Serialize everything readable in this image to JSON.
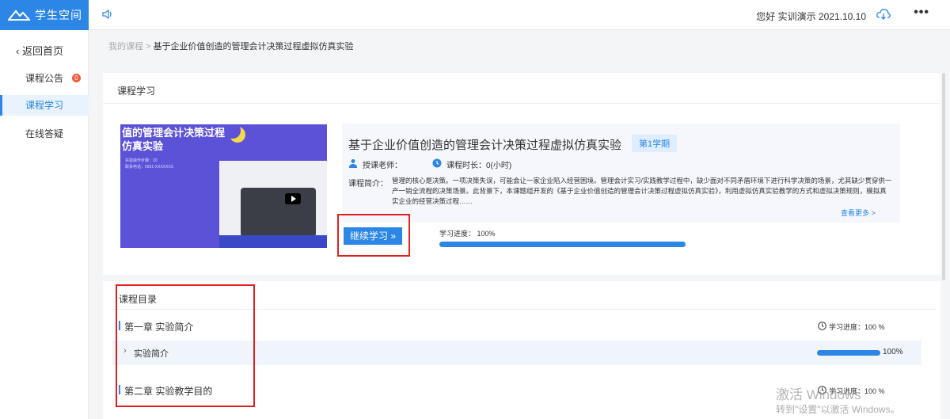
{
  "app": {
    "name": "学生空间"
  },
  "header": {
    "user_info": "您好 实训演示 2021.10.10"
  },
  "sidebar": {
    "back_label": "返回首页",
    "items": [
      {
        "label": "课程公告",
        "badge": "0"
      },
      {
        "label": "课程学习"
      },
      {
        "label": "在线答疑"
      }
    ]
  },
  "breadcrumb": {
    "root": "我的课程",
    "separator": ">",
    "current": "基于企业价值创造的管理会计决策过程虚拟仿真实验"
  },
  "course": {
    "section_title": "课程学习",
    "cover_title_line1": "值的管理会计决策过程",
    "cover_title_line2": "仿真实验",
    "cover_text_1": "实验操作步骤：20",
    "cover_text_2": "联系电话：0931-XXXXXXX",
    "name": "基于企业价值创造的管理会计决策过程虚拟仿真实验",
    "semester": "第1学期",
    "teacher_label": "授课老师：",
    "duration_label": "课程时长：0(小时)",
    "intro_label": "课程简介：",
    "intro_text": "管理的核心是决策。一项决策失误，可能会让一家企业陷入经营困境。管理会计实习/实践教学过程中，缺少面对不同矛盾环境下进行科学决策的场景，尤其缺少贯穿供一产一销全流程的决策场景。此背景下，本课题组开发的《基于企业价值创造的管理会计决策过程虚拟仿真实验》，利用虚拟仿真实验教学的方式和虚拟决策规则，模拟真实企业的经营决策过程……",
    "view_more": "查看更多 >",
    "continue_label": "继续学习 »",
    "progress_label": "学习进度： 100%",
    "progress_value": 100
  },
  "catalog": {
    "title": "课程目录",
    "chapters": [
      {
        "title": "第一章 实验简介",
        "progress": "学习进度：100 %"
      },
      {
        "title": "第二章 实验教学目的",
        "progress": "学习进度：100 %"
      }
    ],
    "section": {
      "title": "实验简介",
      "progress_text": "100%",
      "progress_value": 100
    }
  },
  "watermark": {
    "line1": "激活 Windows",
    "line2": "转到\"设置\"以激活 Windows。"
  },
  "colors": {
    "accent": "#2b86e5",
    "highlight_frame": "#e02020",
    "badge": "#f5593d"
  }
}
